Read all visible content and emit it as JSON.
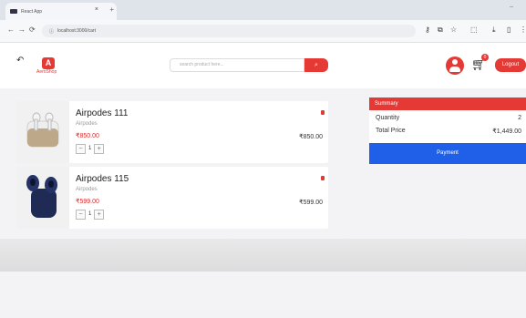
{
  "browser": {
    "tab_title": "React App",
    "url": "localhost:3000/cart"
  },
  "header": {
    "logo_text": "AeroShop",
    "logo_letter": "A",
    "search_placeholder": "search product here...",
    "cart_count": "0",
    "logout_label": "Logout"
  },
  "cart": {
    "items": [
      {
        "name": "Airpodes 111",
        "brand": "Airpodes",
        "price": "₹850.00",
        "quantity": "1",
        "total": "₹850.00"
      },
      {
        "name": "Airpodes 115",
        "brand": "Airpodes",
        "price": "₹599.00",
        "quantity": "1",
        "total": "₹599.00"
      }
    ]
  },
  "summary": {
    "title": "Summary",
    "quantity_label": "Quantity",
    "quantity_value": "2",
    "total_label": "Total Price",
    "total_value": "₹1,449.00",
    "payment_label": "Payment"
  },
  "colors": {
    "accent": "#e53935",
    "payment": "#2060e8"
  },
  "icons": [
    "back-icon",
    "search-icon",
    "user-icon",
    "cart-icon",
    "trash-icon"
  ]
}
